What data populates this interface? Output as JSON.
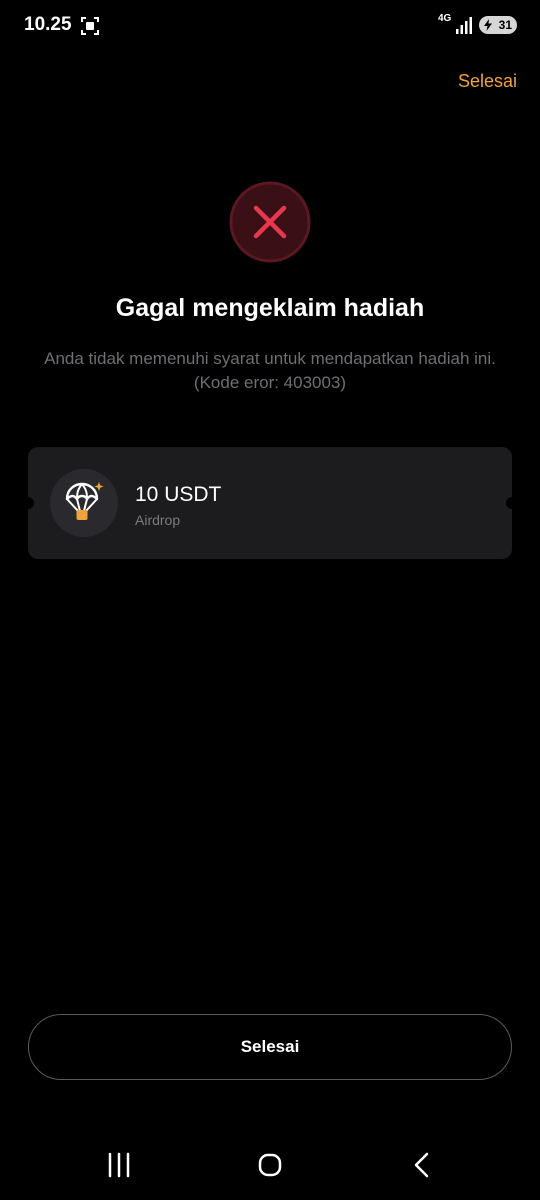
{
  "status_bar": {
    "time": "10.25",
    "network": "4G",
    "battery_level": "31",
    "icons": [
      "screenshot-icon",
      "signal-icon",
      "battery-icon"
    ]
  },
  "header": {
    "done_link": "Selesai"
  },
  "result": {
    "icon": "error-x-icon",
    "title": "Gagal mengeklaim hadiah",
    "message": "Anda tidak memenuhi syarat untuk mendapatkan hadiah ini. (Kode eror: 403003)"
  },
  "reward": {
    "icon": "parachute-airdrop-icon",
    "amount": "10 USDT",
    "type": "Airdrop"
  },
  "footer": {
    "done_button": "Selesai"
  },
  "nav_bar": {
    "icons": [
      "recent-apps-icon",
      "home-icon",
      "back-icon"
    ]
  },
  "colors": {
    "background": "#000000",
    "accent": "#f0a33a",
    "error": "#e8384f",
    "card": "#1c1c1e",
    "muted_text": "#6e6e73"
  }
}
